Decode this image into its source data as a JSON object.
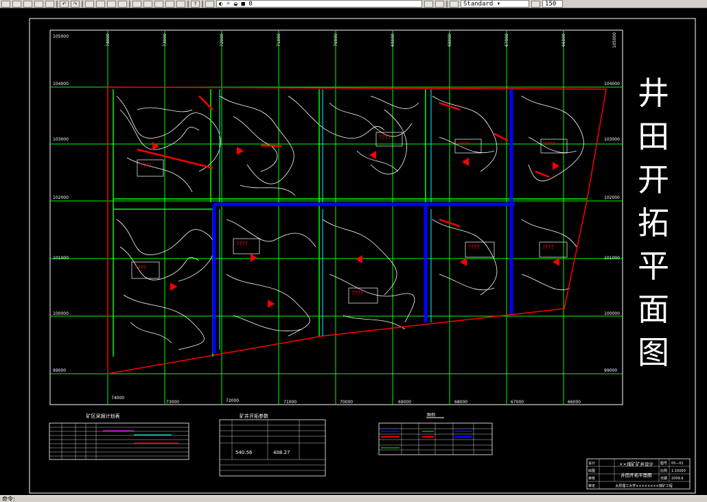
{
  "toolbar": {
    "layer_value": "0",
    "text_style": "Standard",
    "zoom_value": "150",
    "icons": [
      "new-icon",
      "open-icon",
      "save-icon",
      "print-icon",
      "preview-icon",
      "undo-icon",
      "redo-icon",
      "pan-icon",
      "zoom-realtime-icon",
      "zoom-window-icon",
      "zoom-previous-icon",
      "properties-icon",
      "design-center-icon",
      "tool-palette-icon",
      "markup-icon",
      "calculator-icon",
      "help-icon",
      "layer-manager-icon",
      "layer-icon",
      "match-properties-icon",
      "style-icon"
    ]
  },
  "drawing": {
    "title_chars": [
      "井",
      "田",
      "开",
      "拓",
      "平",
      "面",
      "图"
    ],
    "grid_top_labels": [
      "74000",
      "73000",
      "72000",
      "71000",
      "70000",
      "69000",
      "68000",
      "67000",
      "66000"
    ],
    "grid_bottom_labels": [
      "74000",
      "73000",
      "72000",
      "71000",
      "70000",
      "69000",
      "68000",
      "67000",
      "66000"
    ],
    "grid_left_labels": [
      "105000",
      "104000",
      "103000",
      "102000",
      "101000",
      "100000",
      "99000"
    ],
    "grid_right_labels": [
      "105000",
      "104000",
      "103000",
      "102000",
      "101000",
      "100000",
      "99000"
    ],
    "mine_labels": [
      "????",
      "????",
      "????",
      "????",
      "????",
      "????",
      "????",
      "????",
      "????",
      "????"
    ],
    "table1_title": "矿区采掘计划表",
    "table2_title": "矿井开拓参数",
    "table2_values": [
      "540.56",
      "408.27"
    ],
    "table3_title": "图例",
    "titleblock": {
      "design": "设计",
      "drawn": "绘图",
      "check": "审核",
      "approve": "审定",
      "mine_name": "××煤矿矿井设计",
      "drawing_name": "井田开拓平面图",
      "scale_label": "比例",
      "scale_value": "1:10000",
      "date_label": "日期",
      "date_value": "2009.6",
      "number_label": "图号",
      "number_value": "05—01",
      "school": "太原理工大学××××××××煤矿工程"
    }
  },
  "statusbar": {
    "text": "命令:"
  }
}
